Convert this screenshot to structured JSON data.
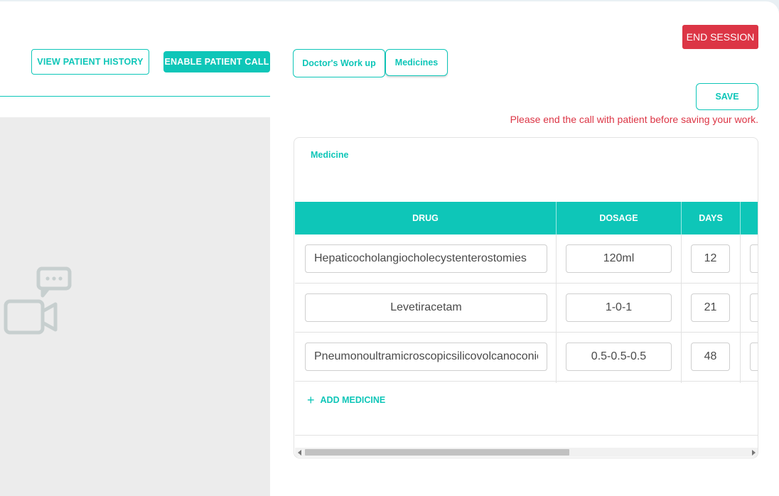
{
  "left_pane": {
    "view_history_label": "VIEW PATIENT HISTORY",
    "enable_call_label": "ENABLE PATIENT CALL",
    "video_placeholder_icon": "video-chat-icon"
  },
  "header": {
    "end_session_label": "END SESSION"
  },
  "tabs": [
    {
      "label": "Doctor's Work up",
      "active": false
    },
    {
      "label": "Medicines",
      "active": true
    }
  ],
  "save_label": "SAVE",
  "warning_text": "Please end the call with patient before saving your work.",
  "medicine_card": {
    "title": "Medicine",
    "columns": [
      "DRUG",
      "DOSAGE",
      "DAYS"
    ],
    "rows": [
      {
        "drug": "Hepaticocholangiocholecystenterostomies",
        "dosage": "120ml",
        "days": "12"
      },
      {
        "drug": "Levetiracetam",
        "dosage": "1-0-1",
        "days": "21"
      },
      {
        "drug": "Pneumonoultramicroscopicsilicovolcanoconiosis",
        "dosage": "0.5-0.5-0.5",
        "days": "48"
      }
    ],
    "add_label": "ADD MEDICINE",
    "add_icon": "plus-icon"
  },
  "colors": {
    "accent": "#0ec6b8",
    "danger": "#dc3545",
    "video_bg": "#ececec"
  }
}
